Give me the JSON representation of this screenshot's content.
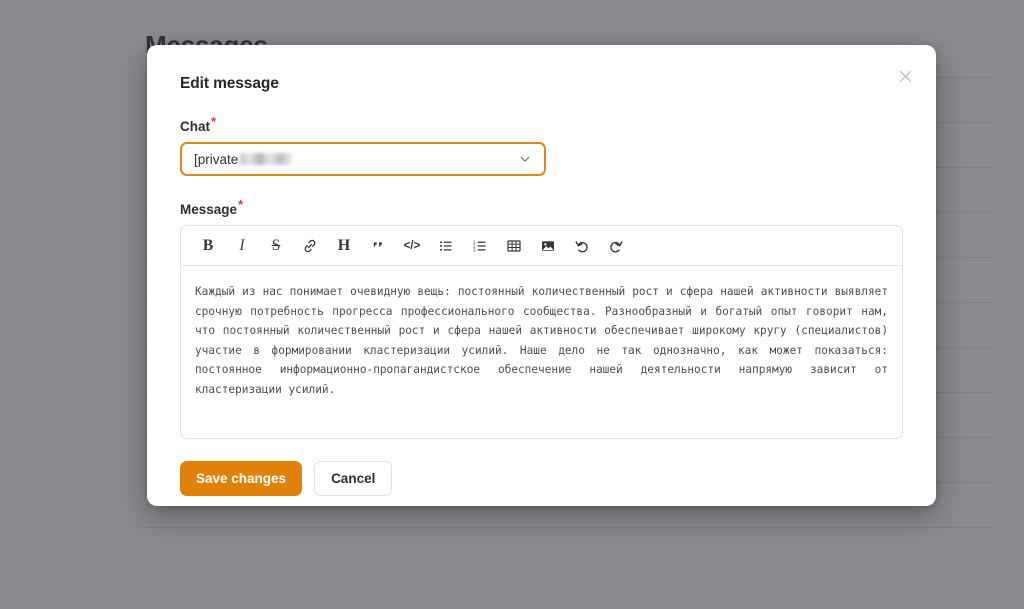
{
  "background": {
    "page_title": "Messages",
    "table_rows": [
      {
        "cells": [
          "",
          "",
          ""
        ]
      },
      {
        "cells": [
          "",
          "",
          ""
        ]
      },
      {
        "cells": [
          "",
          "",
          ""
        ]
      },
      {
        "cells": [
          "",
          "",
          ""
        ]
      },
      {
        "cells": [
          "",
          "",
          ""
        ]
      },
      {
        "cells": [
          "",
          "",
          ""
        ]
      },
      {
        "cells": [
          "",
          "",
          ""
        ]
      },
      {
        "cells": [
          "",
          "",
          ""
        ]
      },
      {
        "cells": [
          "",
          "",
          ""
        ]
      },
      {
        "cells": [
          "",
          "",
          ""
        ]
      }
    ]
  },
  "modal": {
    "title": "Edit message",
    "close_icon": "close-icon",
    "chat_field": {
      "label": "Chat",
      "required_marker": "*",
      "selected_value": "[private",
      "value_is_partially_redacted": true,
      "caret_icon": "chevron-down-icon",
      "focus_border_color": "#dd8a18"
    },
    "message_field": {
      "label": "Message",
      "required_marker": "*",
      "toolbar": [
        {
          "name": "bold-icon",
          "glyph": "B",
          "title": "Bold"
        },
        {
          "name": "italic-icon",
          "glyph": "I",
          "title": "Italic"
        },
        {
          "name": "strikethrough-icon",
          "glyph": "S",
          "title": "Strikethrough"
        },
        {
          "name": "link-icon",
          "glyph": "",
          "title": "Link"
        },
        {
          "name": "heading-icon",
          "glyph": "H",
          "title": "Heading"
        },
        {
          "name": "blockquote-icon",
          "glyph": "“",
          "title": "Quote"
        },
        {
          "name": "code-icon",
          "glyph": "</>",
          "title": "Code"
        },
        {
          "name": "bullet-list-icon",
          "glyph": "",
          "title": "Bullet list"
        },
        {
          "name": "numbered-list-icon",
          "glyph": "",
          "title": "Numbered list"
        },
        {
          "name": "table-icon",
          "glyph": "",
          "title": "Table"
        },
        {
          "name": "image-icon",
          "glyph": "",
          "title": "Image"
        },
        {
          "name": "undo-icon",
          "glyph": "",
          "title": "Undo"
        },
        {
          "name": "redo-icon",
          "glyph": "",
          "title": "Redo"
        }
      ],
      "content": "Каждый из нас понимает очевидную вещь: постоянный количественный рост и сфера нашей активности выявляет срочную потребность прогресса профессионального сообщества. Разнообразный и богатый опыт говорит нам, что постоянный количественный рост и сфера нашей активности обеспечивает широкому кругу (специалистов) участие в формировании кластеризации усилий. Наше дело не так однозначно, как может показаться: постоянное информационно-пропагандистское обеспечение нашей деятельности напрямую зависит от кластеризации усилий."
    },
    "footer": {
      "save_label": "Save changes",
      "cancel_label": "Cancel",
      "save_color": "#e08209"
    }
  }
}
